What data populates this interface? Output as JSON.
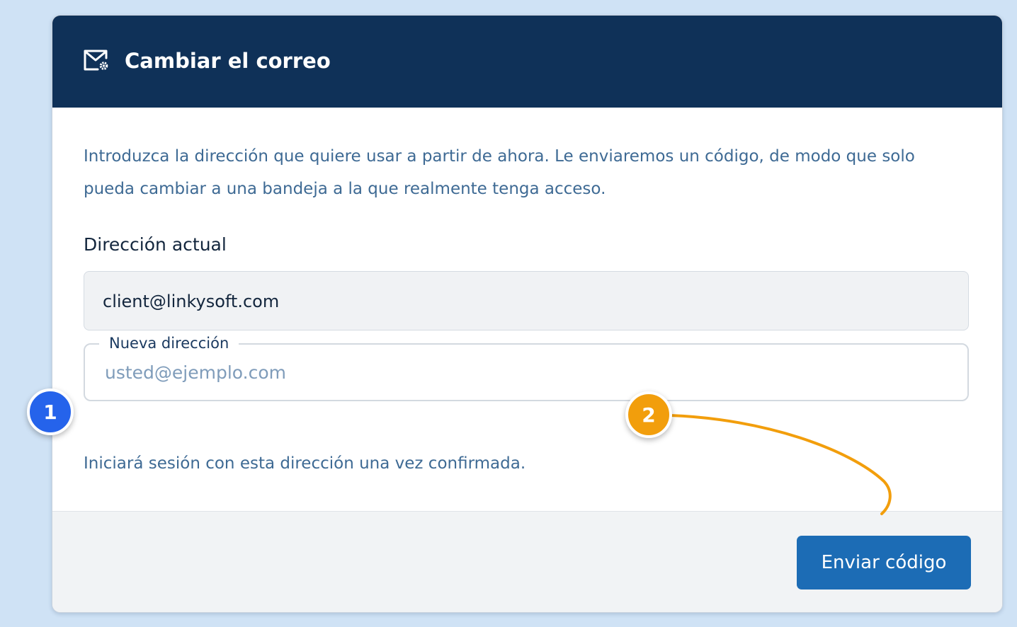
{
  "header": {
    "icon": "mail-settings-icon",
    "title": "Cambiar el correo"
  },
  "body": {
    "intro": "Introduzca la dirección que quiere usar a partir de ahora. Le enviaremos un código, de modo que solo pueda cambiar a una bandeja a la que realmente tenga acceso.",
    "current_label": "Dirección actual",
    "current_value": "client@linkysoft.com",
    "new_label": "Nueva dirección",
    "new_placeholder": "usted@ejemplo.com",
    "new_value": "",
    "hint": "Iniciará sesión con esta dirección una vez confirmada."
  },
  "footer": {
    "submit_label": "Enviar código"
  },
  "annotations": [
    {
      "label": "1",
      "color": "#2563eb"
    },
    {
      "label": "2",
      "color": "#f29e0c"
    }
  ],
  "colors": {
    "header_bg": "#0f3158",
    "button_bg": "#1c6cb5",
    "page_bg": "#cfe2f5"
  }
}
